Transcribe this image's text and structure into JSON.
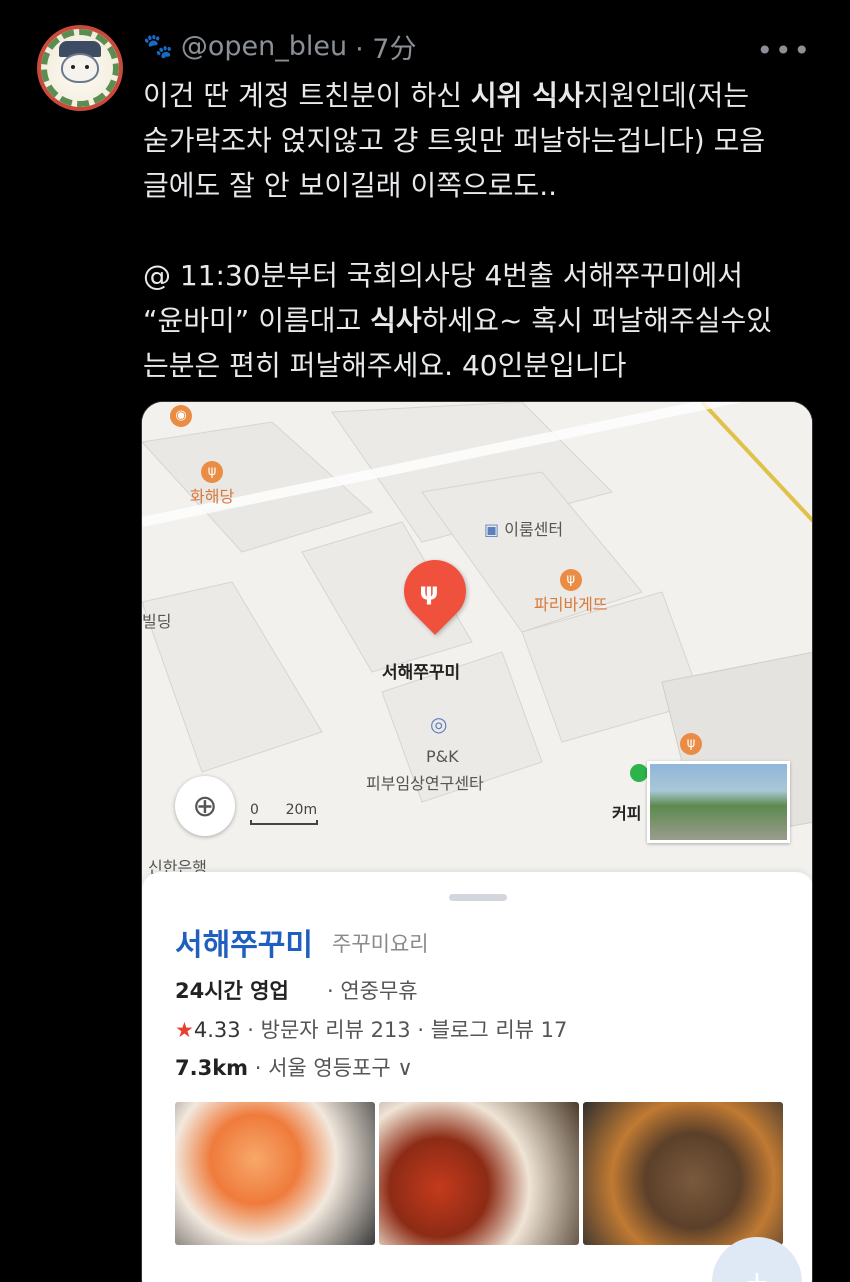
{
  "tweet": {
    "handle": "@open_bleu",
    "time": "· 7分",
    "more": "•••",
    "lines": [
      [
        "이건 딴 계정 트친분이 하신 ",
        "시위 식사",
        "지원인데(저는"
      ],
      [
        "숟가락조차 얹지않고 걍 트윗만 퍼날하는겁니다) 모음"
      ],
      [
        "글에도 잘 안 보이길래 이쪽으로도.."
      ],
      [
        "@ 11:30분부터 국회의사당 4번출 서해쭈꾸미에서"
      ],
      [
        "“윤바미” 이름대고 ",
        "식사",
        "하세요~ 혹시 퍼날해주실수있"
      ],
      [
        "는분은 편히 퍼날해주세요.  40인분입니다"
      ]
    ]
  },
  "map": {
    "pois": {
      "hwahaedang": "화해당",
      "iroom": "이룸센터",
      "paris": "파리바게뜨",
      "building": "빌딩",
      "selected": "서해쭈꾸미",
      "pk_1": "P&K",
      "pk_2": "피부임상연구센타",
      "shinhan": "신한은행",
      "cafe": "커피"
    },
    "scale": {
      "zero": "0",
      "dist": "20m"
    },
    "locate_icon": "⊕"
  },
  "sheet": {
    "name": "서해쭈꾸미",
    "category": "주꾸미요리",
    "hours": "24시간 영업",
    "hours_extra": "· 연중무휴",
    "rating_star": "★",
    "rating": "4.33",
    "reviews": "· 방문자 리뷰 213 · 블로그 리뷰 17",
    "distance": "7.3km",
    "address": "· 서울 영등포구 ∨",
    "fab_icon": "+"
  },
  "colors": {
    "accent": "#1f5fbf",
    "pin": "#f0513d",
    "star": "#e8402f"
  }
}
